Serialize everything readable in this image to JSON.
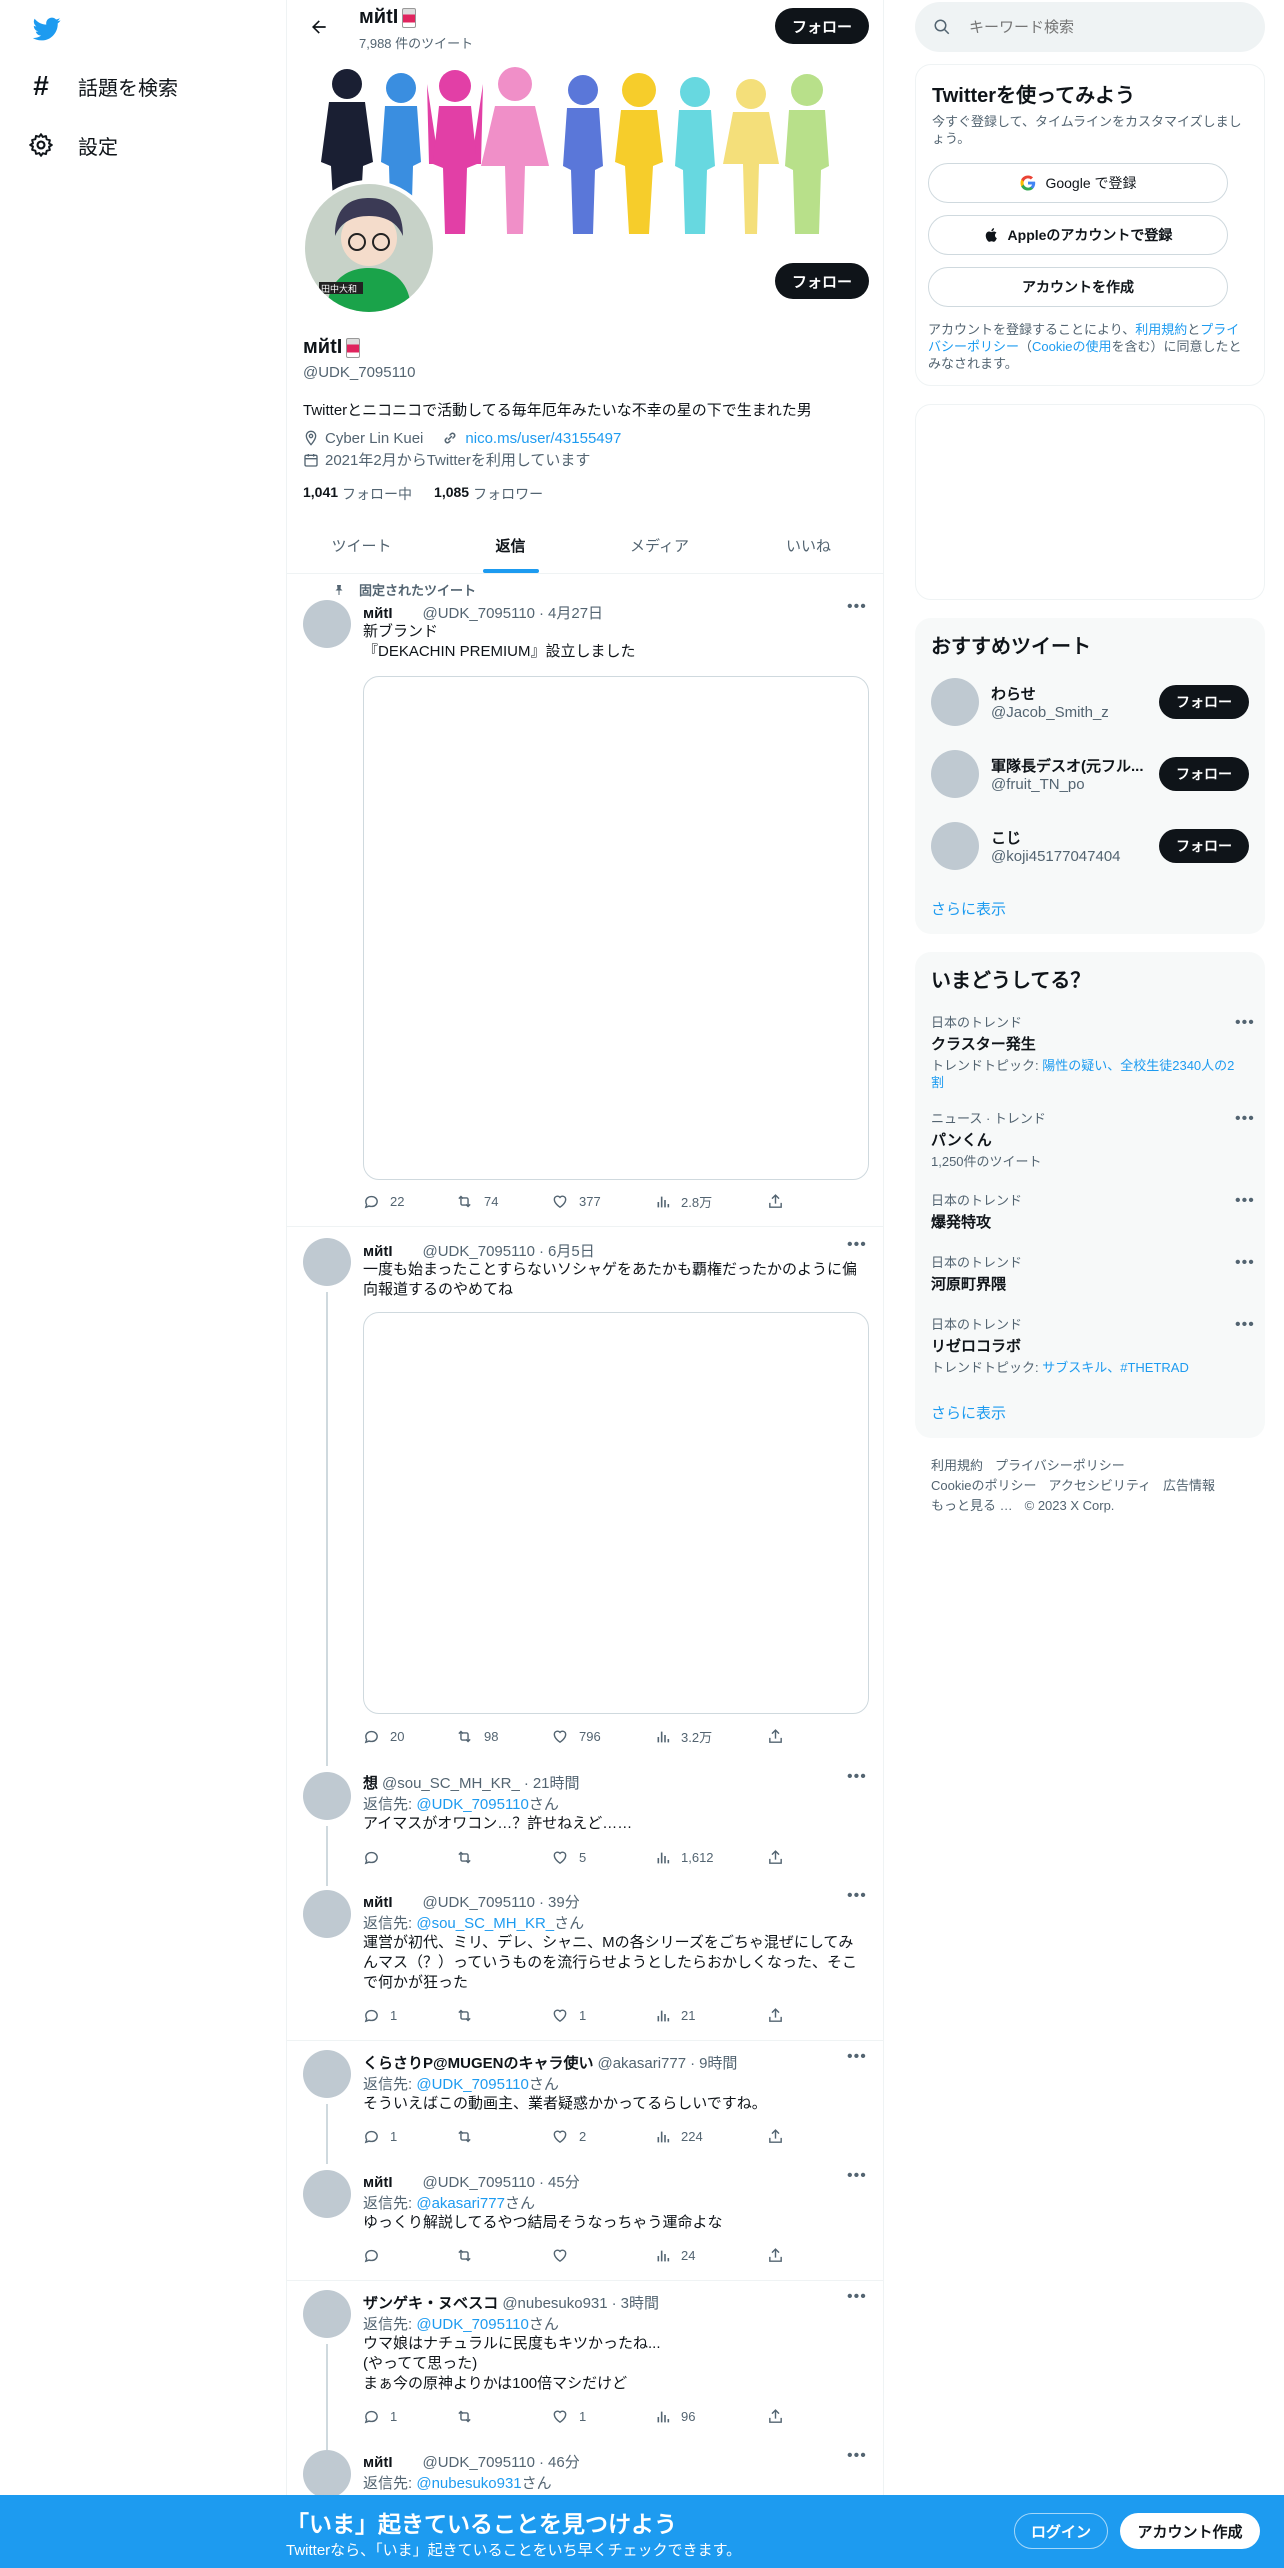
{
  "colors": {
    "accent": "#1d9bf0",
    "dark": "#0f1419",
    "muted": "#536471",
    "border": "#cfd9de"
  },
  "nav": {
    "explore": "話題を検索",
    "settings": "設定"
  },
  "profile": {
    "header_name": "мйtI",
    "tweet_count": "7,988 件のツイート",
    "follow": "フォロー",
    "display_name": "мйtI",
    "handle": "@UDK_7095110",
    "bio": "Twitterとニコニコで活動してる毎年厄年みたいな不幸の星の下で生まれた男",
    "location": "Cyber Lin Kuei",
    "website": "nico.ms/user/43155497",
    "joined": "2021年2月からTwitterを利用しています",
    "following_count": "1,041",
    "following_label": "フォロー中",
    "followers_count": "1,085",
    "followers_label": "フォロワー",
    "avatar_caption": "田中大和"
  },
  "tabs": [
    "ツイート",
    "返信",
    "メディア",
    "いいね"
  ],
  "pinned_label": "固定されたツイート",
  "tweets": [
    {
      "name": "мйtI",
      "handle": "@UDK_7095110",
      "time": "4月27日",
      "text": "新ブランド\n『DEKACHIN PREMIUM』設立しました",
      "reply": "22",
      "retweet": "74",
      "like": "377",
      "views": "2.8万"
    },
    {
      "name": "мйtI",
      "handle": "@UDK_7095110",
      "time": "6月5日",
      "text": "一度も始まったことすらないソシャゲをあたかも覇権だったかのように偏\n向報道するのやめてね",
      "reply": "20",
      "retweet": "98",
      "like": "796",
      "views": "3.2万"
    },
    {
      "name": "想",
      "handle": "@sou_SC_MH_KR_",
      "time": "21時間",
      "reply_prefix": "返信先: ",
      "reply_to": "@UDK_7095110",
      "reply_suffix": "さん",
      "text": "アイマスがオワコン…？許せねえど……",
      "reply": "",
      "retweet": "",
      "like": "5",
      "views": "1,612"
    },
    {
      "name": "мйtI",
      "handle": "@UDK_7095110",
      "time": "39分",
      "reply_prefix": "返信先: ",
      "reply_to": "@sou_SC_MH_KR_",
      "reply_suffix": "さん",
      "text": "運営が初代、ミリ、デレ、シャニ、Mの各シリーズをごちゃ混ぜにしてみ\nんマス（？）っていうものを流行らせようとしたらおかしくなった、そこ\nで何かが狂った",
      "reply": "1",
      "retweet": "",
      "like": "1",
      "views": "21"
    },
    {
      "name": "くらさりP@MUGENのキャラ使い",
      "handle": "@akasari777",
      "time": "9時間",
      "reply_prefix": "返信先: ",
      "reply_to": "@UDK_7095110",
      "reply_suffix": "さん",
      "text": "そういえばこの動画主、業者疑惑かかってるらしいですね。",
      "reply": "1",
      "retweet": "",
      "like": "2",
      "views": "224"
    },
    {
      "name": "мйtI",
      "handle": "@UDK_7095110",
      "time": "45分",
      "reply_prefix": "返信先: ",
      "reply_to": "@akasari777",
      "reply_suffix": "さん",
      "text": "ゆっくり解説してるやつ結局そうなっちゃう運命よな",
      "reply": "",
      "retweet": "",
      "like": "",
      "views": "24"
    },
    {
      "name": "ザンゲキ・ヌベスコ",
      "handle": "@nubesuko931",
      "time": "3時間",
      "reply_prefix": "返信先: ",
      "reply_to": "@UDK_7095110",
      "reply_suffix": "さん",
      "text": "ウマ娘はナチュラルに民度もキツかったね...\n(やってて思った)\nまぁ今の原神よりかは100倍マシだけど",
      "reply": "1",
      "retweet": "",
      "like": "1",
      "views": "96"
    },
    {
      "name": "мйtI",
      "handle": "@UDK_7095110",
      "time": "46分",
      "reply_prefix": "返信先: ",
      "reply_to": "@nubesuko931",
      "reply_suffix": "さん"
    }
  ],
  "sidebar": {
    "search_placeholder": "キーワード検索",
    "signup": {
      "title": "Twitterを使ってみよう",
      "subtitle": "今すぐ登録して、タイムラインをカスタマイズしましょう。",
      "google": "Google で登録",
      "apple": "Appleのアカウントで登録",
      "create": "アカウントを作成",
      "legal_1": "アカウントを登録することにより、",
      "terms": "利用規約",
      "legal_2": "と",
      "privacy": "プライバシーポリシー",
      "legal_3": "（",
      "cookie": "Cookieの使用",
      "legal_4": "を含む）に同意したとみなされます。"
    },
    "recommend": {
      "title": "おすすめツイート",
      "follow": "フォロー",
      "show_more": "さらに表示",
      "users": [
        {
          "name": "わらせ",
          "handle": "@Jacob_Smith_z"
        },
        {
          "name": "軍隊長デスオ(元フル...",
          "handle": "@fruit_TN_po"
        },
        {
          "name": "こじ",
          "handle": "@koji45177047404"
        }
      ]
    },
    "trends": {
      "title": "いまどうしてる？",
      "show_more": "さらに表示",
      "items": [
        {
          "meta": "日本のトレンド",
          "name": "クラスター発生",
          "sub_prefix": "トレンドトピック: ",
          "sub_links": "陽性の疑い、全校生徒2340人の2\n割"
        },
        {
          "meta": "ニュース · トレンド",
          "name": "パンくん",
          "sub_prefix": "1,250件のツイート",
          "sub_links": ""
        },
        {
          "meta": "日本のトレンド",
          "name": "爆発特攻"
        },
        {
          "meta": "日本のトレンド",
          "name": "河原町界隈"
        },
        {
          "meta": "日本のトレンド",
          "name": "リゼロコラボ",
          "sub_prefix": "トレンドトピック: ",
          "sub_links": "サブスキル、#THETRAD"
        }
      ]
    },
    "footer": {
      "terms": "利用規約",
      "privacy": "プライバシーポリシー",
      "cookie": "Cookieのポリシー",
      "access": "アクセシビリティ",
      "ads": "広告情報",
      "more": "もっと見る …",
      "copy": "© 2023 X Corp."
    }
  },
  "bottom": {
    "headline": "「いま」起きていることを見つけよう",
    "sub": "Twitterなら、「いま」起きていることをいち早くチェックできます。",
    "login": "ログイン",
    "signup": "アカウント作成"
  }
}
